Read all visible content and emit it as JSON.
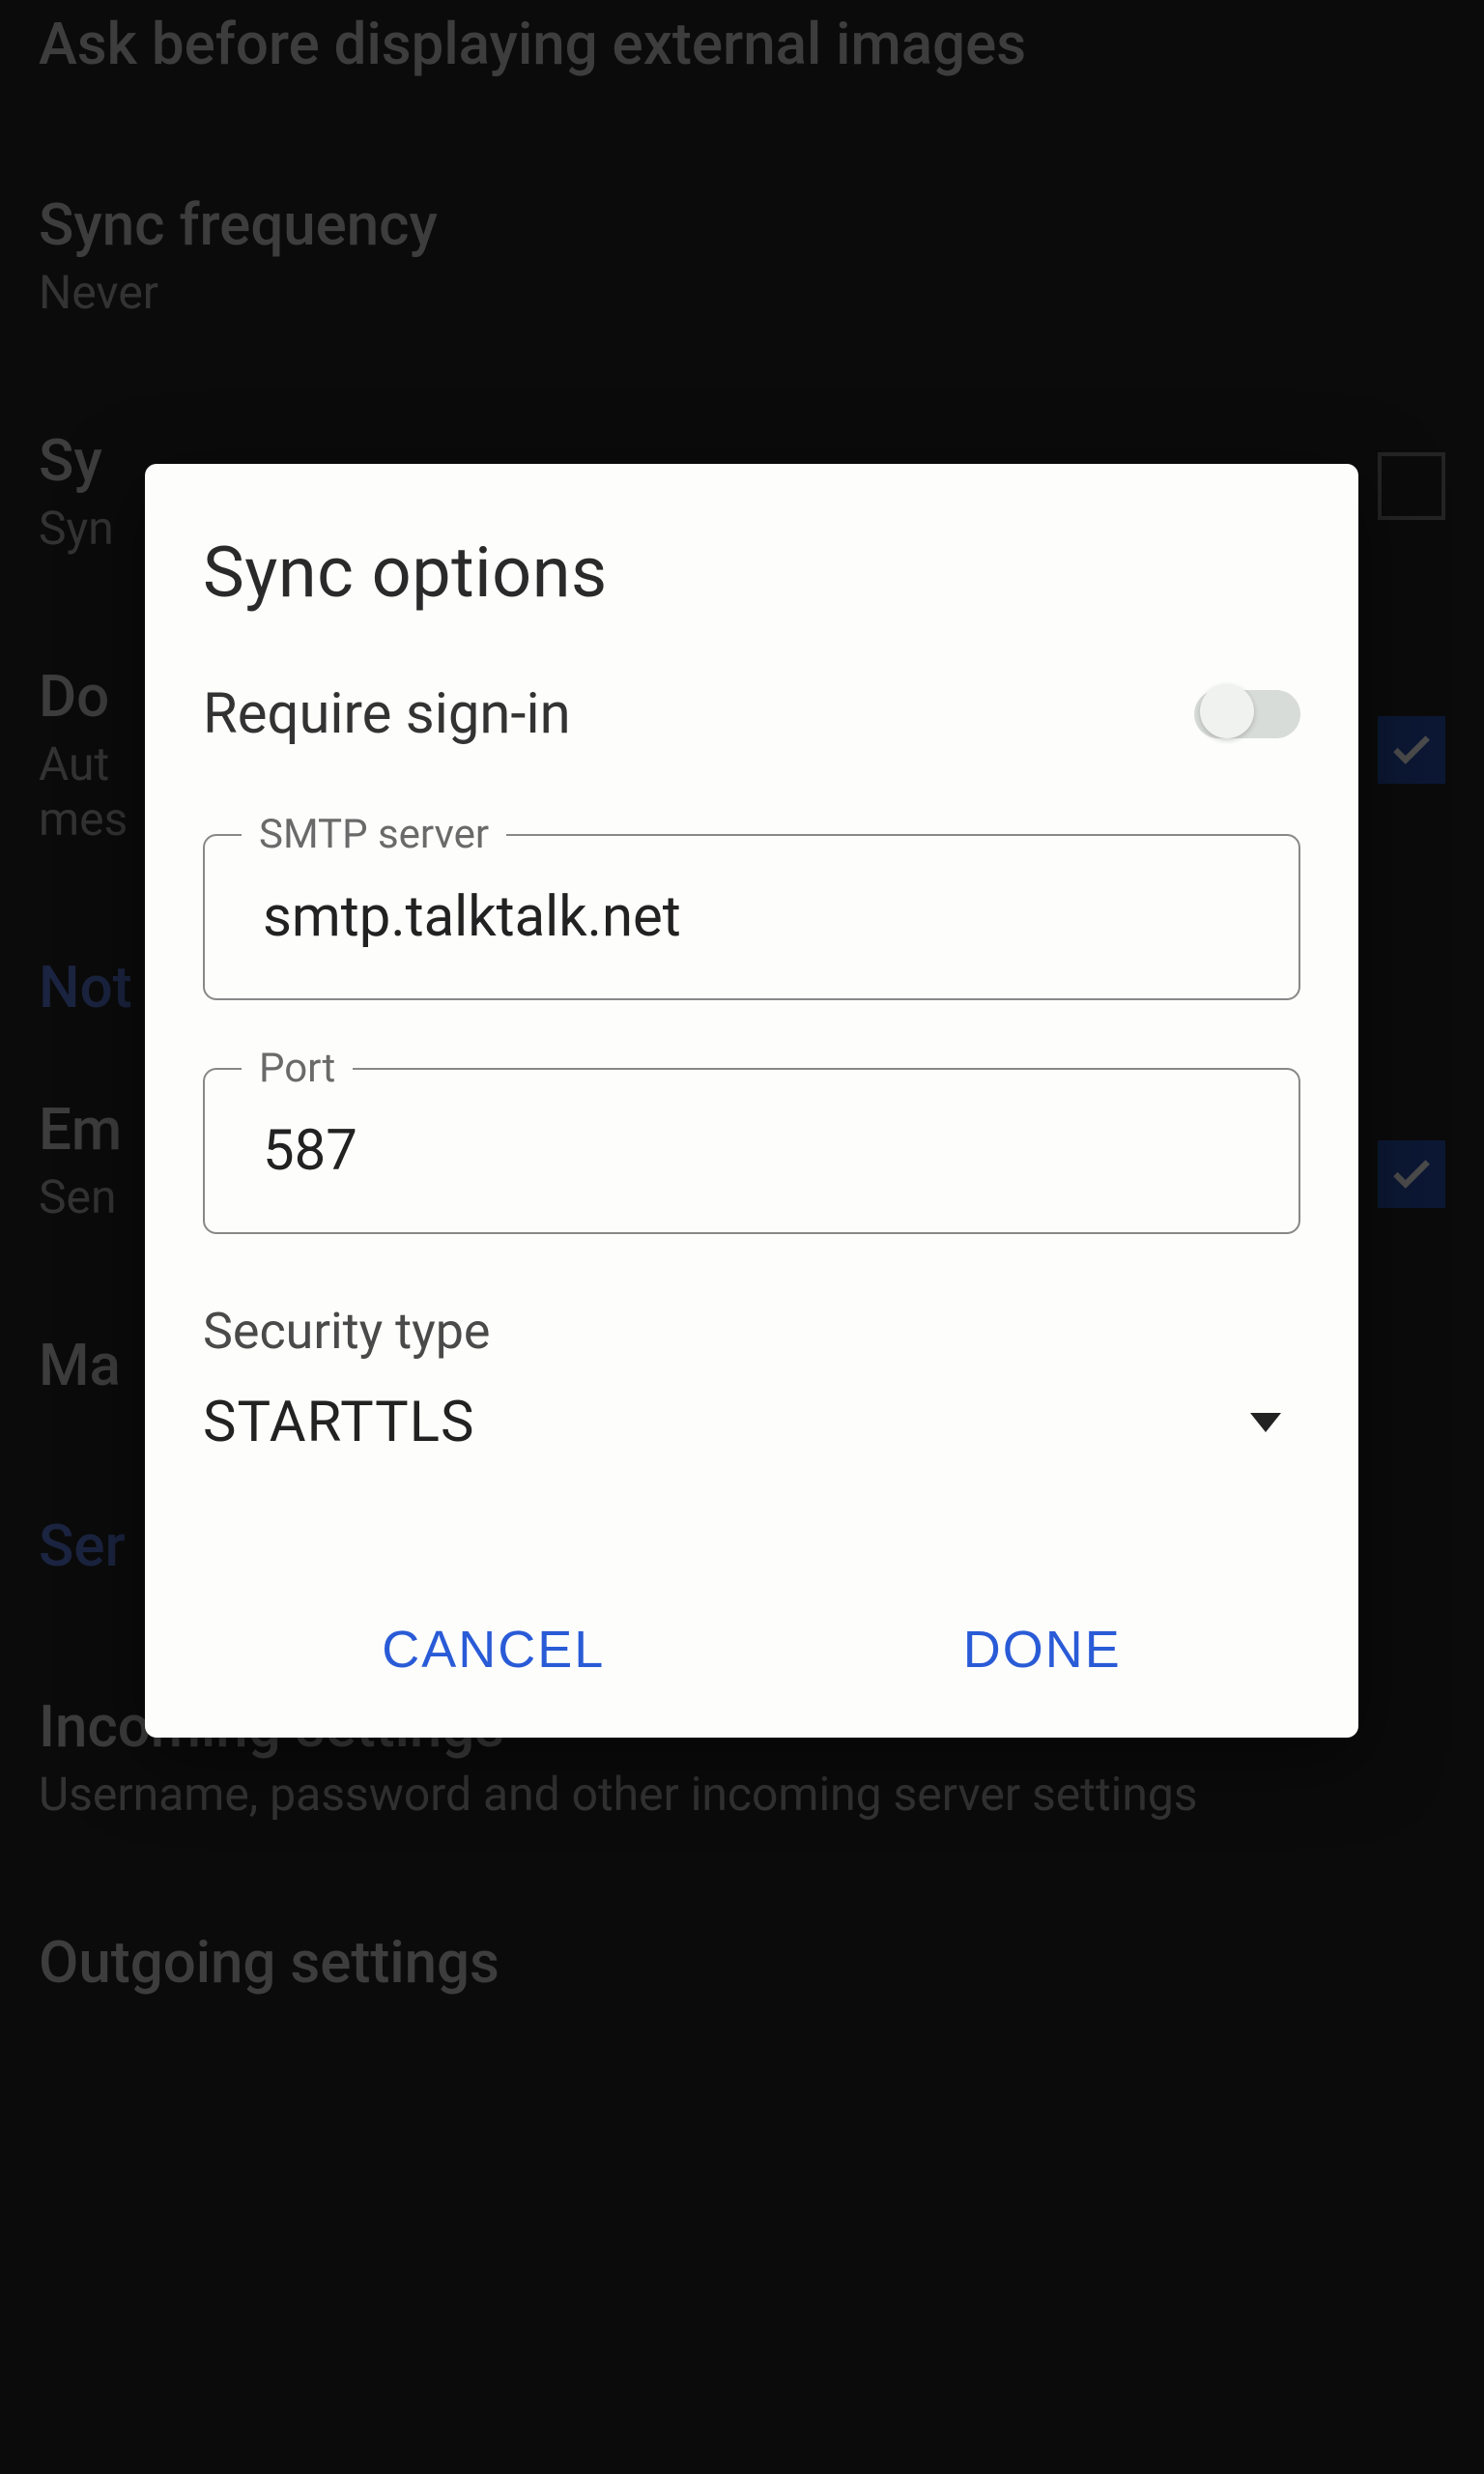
{
  "backdrop": {
    "row0": "Ask before displaying external images",
    "row1_title": "Sync frequency",
    "row1_sub": "Never",
    "row2_title": "Sy",
    "row2_sub": "Syn",
    "row3_title": "Do",
    "row3_sub1": "Aut",
    "row3_sub2": "mes",
    "row4_accent": "Not",
    "row5_title": "Em",
    "row5_sub": "Sen",
    "row6_title": "Ma",
    "row7_accent": "Ser",
    "row8_title": "Incoming settings",
    "row8_sub": "Username, password and other incoming server settings",
    "row9_title": "Outgoing settings"
  },
  "dialog": {
    "title": "Sync options",
    "require_signin_label": "Require sign-in",
    "require_signin_on": false,
    "smtp_label": "SMTP server",
    "smtp_value": "smtp.talktalk.net",
    "port_label": "Port",
    "port_value": "587",
    "security_label": "Security type",
    "security_value": "STARTTLS",
    "cancel": "CANCEL",
    "done": "DONE"
  }
}
